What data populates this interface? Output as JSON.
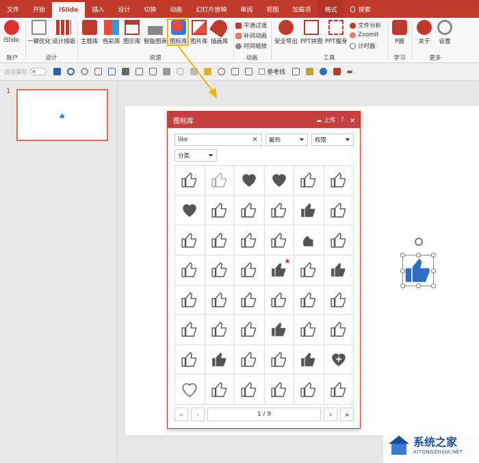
{
  "tabs": [
    "文件",
    "开始",
    "iSlide",
    "插入",
    "设计",
    "切换",
    "动画",
    "幻灯片放映",
    "审阅",
    "视图",
    "加载项",
    "格式",
    "搜索"
  ],
  "ribbon": {
    "account": {
      "label": "账户",
      "buttons": [
        "iSlide"
      ]
    },
    "design": {
      "label": "设计",
      "buttons": [
        "一键优化",
        "设计排版"
      ]
    },
    "resources": {
      "label": "资源",
      "buttons": [
        "主题库",
        "色彩库",
        "图示库",
        "智能图表",
        "图标库",
        "图片库",
        "插画库"
      ]
    },
    "animation": {
      "label": "动画",
      "buttons": [
        "平滑过渡",
        "补间动画",
        "时间缩放"
      ]
    },
    "tools": {
      "label": "工具",
      "buttons": [
        "安全导出",
        "PPT拼图",
        "PPT瘦身",
        "文件分析",
        "ZoomIt",
        "计时器"
      ]
    },
    "learn": {
      "label": "学习",
      "buttons": [
        "P圈"
      ]
    },
    "more": {
      "label": "更多",
      "buttons": [
        "关于",
        "设置"
      ]
    }
  },
  "qat": {
    "autosave": "自动保存",
    "gridlines": "参考线"
  },
  "slides": {
    "number": "1"
  },
  "dialog": {
    "title": "图标库",
    "upload": "上传",
    "help": "?",
    "close": "×",
    "search_value": "like",
    "sort": "最热",
    "permission": "权限",
    "category": "分类",
    "page": "1 / 9"
  },
  "watermark": {
    "name": "系统之家",
    "domain": "XITONGZHIJIA.NET"
  },
  "colors": {
    "accent": "#c0392b",
    "icon_blue": "#2f6cc4",
    "highlight": "#f0b400"
  }
}
